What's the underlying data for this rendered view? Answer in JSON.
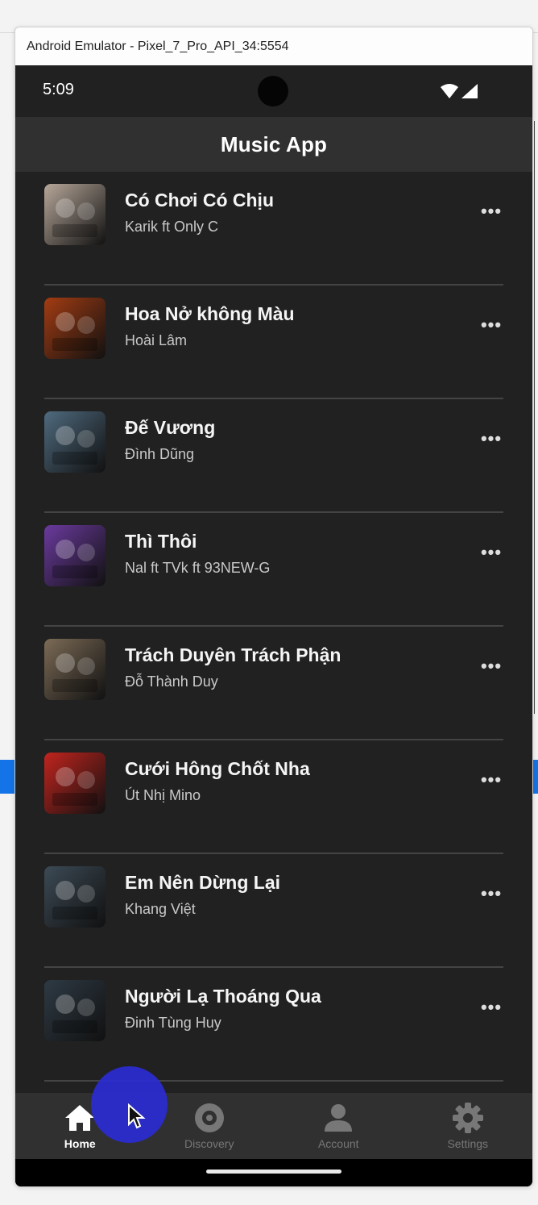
{
  "window": {
    "title": "Android Emulator - Pixel_7_Pro_API_34:5554"
  },
  "status_bar": {
    "time": "5:09"
  },
  "app_bar": {
    "title": "Music App"
  },
  "songs": [
    {
      "title": "Có Chơi Có Chịu",
      "artist": "Karik ft Only C",
      "art_color": "#b7a79a"
    },
    {
      "title": "Hoa Nở không Màu",
      "artist": "Hoài Lâm",
      "art_color": "#a33c12"
    },
    {
      "title": "Đế Vương",
      "artist": "Đình Dũng",
      "art_color": "#4f6a7e"
    },
    {
      "title": "Thì Thôi",
      "artist": "Nal ft TVk ft 93NEW-G",
      "art_color": "#6b3a9e"
    },
    {
      "title": "Trách Duyên Trách Phận",
      "artist": "Đỗ Thành Duy",
      "art_color": "#7c6b56"
    },
    {
      "title": "Cưới Hông Chốt Nha",
      "artist": "Út Nhị Mino",
      "art_color": "#c1241e"
    },
    {
      "title": "Em Nên Dừng Lại",
      "artist": "Khang Việt",
      "art_color": "#3c4a55"
    },
    {
      "title": "Người Lạ Thoáng Qua",
      "artist": "Đinh Tùng Huy",
      "art_color": "#2e3a44"
    }
  ],
  "more_label": "•••",
  "bottom_nav": [
    {
      "label": "Home",
      "icon": "home-icon",
      "active": true
    },
    {
      "label": "Discovery",
      "icon": "disc-icon",
      "active": false
    },
    {
      "label": "Account",
      "icon": "person-icon",
      "active": false
    },
    {
      "label": "Settings",
      "icon": "gear-icon",
      "active": false
    }
  ],
  "colors": {
    "background": "#212121",
    "app_bar": "#303030",
    "divider": "#444444",
    "cursor_highlight": "#2b2bd6"
  }
}
